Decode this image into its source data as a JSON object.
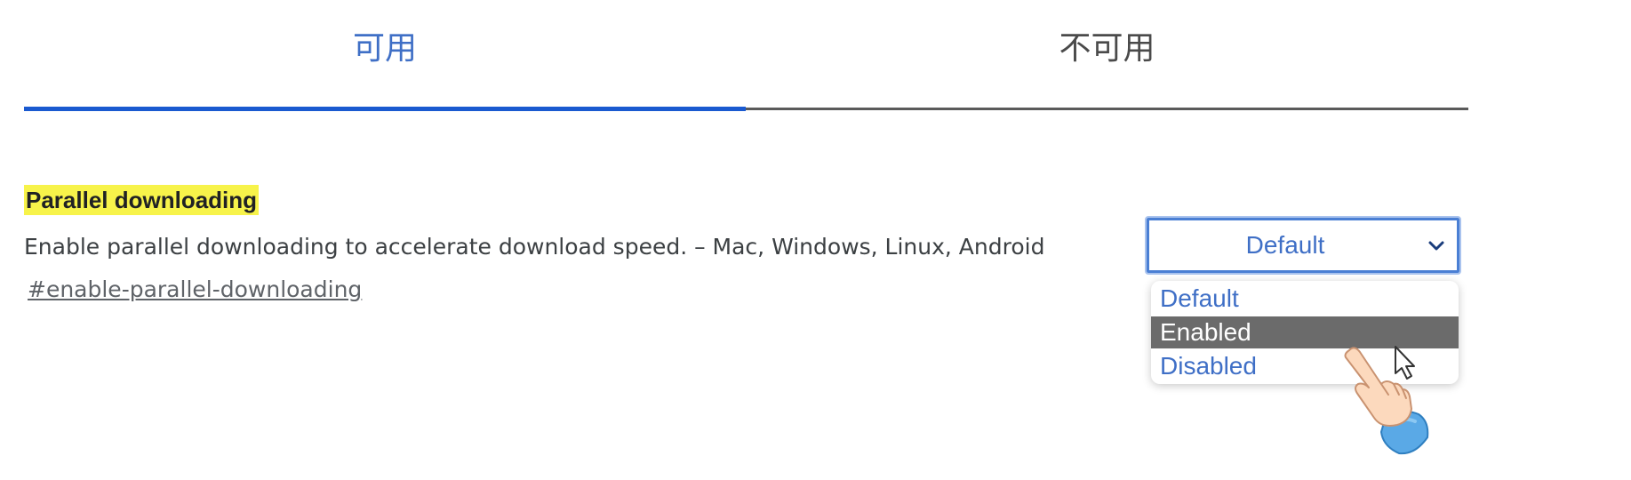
{
  "tabs": [
    {
      "label": "可用",
      "active": true
    },
    {
      "label": "不可用",
      "active": false
    }
  ],
  "flag": {
    "title": "Parallel downloading",
    "description": "Enable parallel downloading to accelerate download speed. – Mac, Windows, Linux, Android",
    "anchor": "#enable-parallel-downloading"
  },
  "select": {
    "value": "Default",
    "options": [
      "Default",
      "Enabled",
      "Disabled"
    ],
    "highlighted": "Enabled"
  },
  "colors": {
    "accent": "#1a5ad0",
    "highlight": "#f7f34a",
    "option_highlight": "#6b6b6b"
  },
  "icons": {
    "dropdown": "chevron-down-icon",
    "pointer": "pointing-hand-icon",
    "cursor": "mouse-cursor-icon"
  }
}
